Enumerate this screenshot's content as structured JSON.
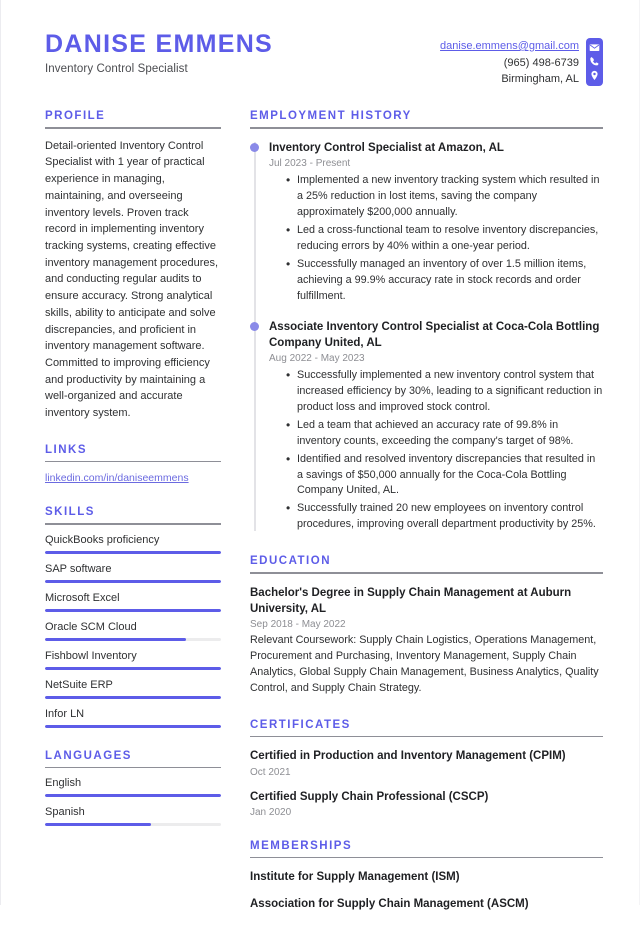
{
  "header": {
    "name": "DANISE EMMENS",
    "job_title": "Inventory Control Specialist",
    "contact": {
      "email": "danise.emmens@gmail.com",
      "phone": "(965) 498-6739",
      "location": "Birmingham, AL",
      "icons": [
        "envelope-icon",
        "phone-icon",
        "location-pin-icon"
      ]
    }
  },
  "theme": {
    "accent": "#5d5ce8",
    "accent_light": "#8a8ae8",
    "text": "#2f3032",
    "muted": "#8d8e93",
    "rule": "#8e8f97",
    "track": "#ececed"
  },
  "left": {
    "profile": {
      "title": "PROFILE",
      "text": "Detail-oriented Inventory Control Specialist with 1 year of practical experience in managing, maintaining, and overseeing inventory levels. Proven track record in implementing inventory tracking systems, creating effective inventory management procedures, and conducting regular audits to ensure accuracy. Strong analytical skills, ability to anticipate and solve discrepancies, and proficient in inventory management software. Committed to improving efficiency and productivity by maintaining a well-organized and accurate inventory system."
    },
    "links": {
      "title": "LINKS",
      "items": [
        {
          "label": "linkedin.com/in/daniseemmens"
        }
      ]
    },
    "skills": {
      "title": "SKILLS",
      "items": [
        {
          "label": "QuickBooks proficiency",
          "level": 100
        },
        {
          "label": "SAP software",
          "level": 100
        },
        {
          "label": "Microsoft Excel",
          "level": 100
        },
        {
          "label": "Oracle SCM Cloud",
          "level": 80
        },
        {
          "label": "Fishbowl Inventory",
          "level": 100
        },
        {
          "label": "NetSuite ERP",
          "level": 100
        },
        {
          "label": "Infor LN",
          "level": 100
        }
      ]
    },
    "languages": {
      "title": "LANGUAGES",
      "items": [
        {
          "label": "English",
          "level": 100
        },
        {
          "label": "Spanish",
          "level": 60
        }
      ]
    }
  },
  "right": {
    "employment": {
      "title": "EMPLOYMENT HISTORY",
      "entries": [
        {
          "title": "Inventory Control Specialist at Amazon, AL",
          "date": "Jul 2023 - Present",
          "bullets": [
            "Implemented a new inventory tracking system which resulted in a 25% reduction in lost items, saving the company approximately $200,000 annually.",
            "Led a cross-functional team to resolve inventory discrepancies, reducing errors by 40% within a one-year period.",
            "Successfully managed an inventory of over 1.5 million items, achieving a 99.9% accuracy rate in stock records and order fulfillment."
          ]
        },
        {
          "title": "Associate Inventory Control Specialist at Coca-Cola Bottling Company United, AL",
          "date": "Aug 2022 - May 2023",
          "bullets": [
            "Successfully implemented a new inventory control system that increased efficiency by 30%, leading to a significant reduction in product loss and improved stock control.",
            "Led a team that achieved an accuracy rate of 99.8% in inventory counts, exceeding the company's target of 98%.",
            "Identified and resolved inventory discrepancies that resulted in a savings of $50,000 annually for the Coca-Cola Bottling Company United, AL.",
            "Successfully trained 20 new employees on inventory control procedures, improving overall department productivity by 25%."
          ]
        }
      ]
    },
    "education": {
      "title": "EDUCATION",
      "entries": [
        {
          "title": "Bachelor's Degree in Supply Chain Management at Auburn University, AL",
          "date": "Sep 2018 - May 2022",
          "description": "Relevant Coursework: Supply Chain Logistics, Operations Management, Procurement and Purchasing, Inventory Management, Supply Chain Analytics, Global Supply Chain Management, Business Analytics, Quality Control, and Supply Chain Strategy."
        }
      ]
    },
    "certificates": {
      "title": "CERTIFICATES",
      "entries": [
        {
          "title": "Certified in Production and Inventory Management (CPIM)",
          "date": "Oct 2021"
        },
        {
          "title": "Certified Supply Chain Professional (CSCP)",
          "date": "Jan 2020"
        }
      ]
    },
    "memberships": {
      "title": "MEMBERSHIPS",
      "entries": [
        {
          "title": "Institute for Supply Management (ISM)"
        },
        {
          "title": "Association for Supply Chain Management (ASCM)"
        }
      ]
    }
  }
}
